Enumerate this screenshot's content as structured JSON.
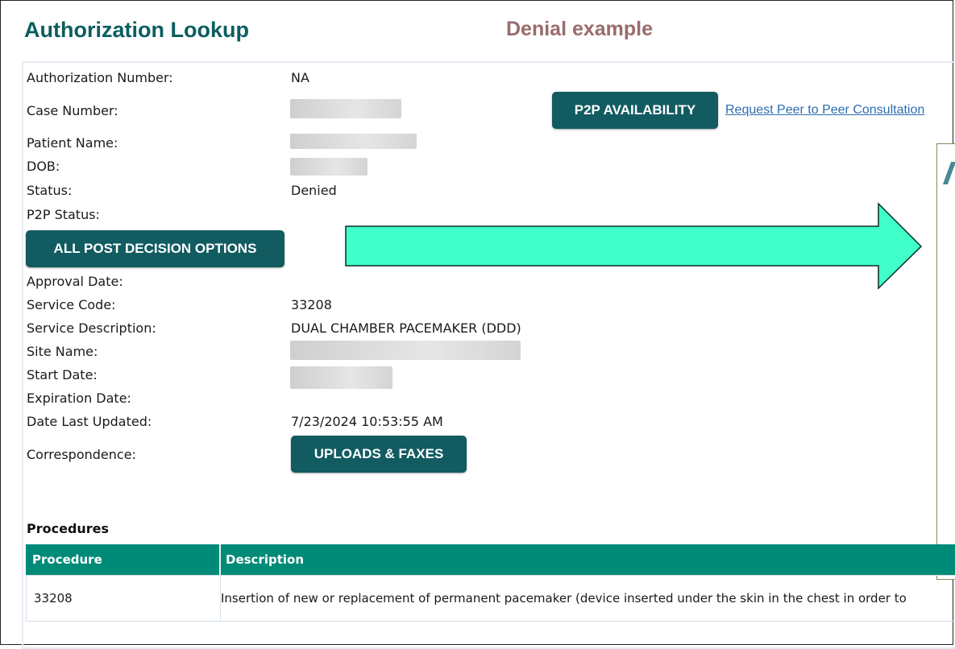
{
  "header": {
    "app_title": "Authorization Lookup",
    "slide_label": "Denial example"
  },
  "fields": {
    "authorization_number": {
      "label": "Authorization Number:",
      "value": "NA"
    },
    "case_number": {
      "label": "Case Number:"
    },
    "patient_name": {
      "label": "Patient Name:"
    },
    "dob": {
      "label": "DOB:"
    },
    "status": {
      "label": "Status:",
      "value": "Denied"
    },
    "p2p_status": {
      "label": "P2P Status:",
      "value": ""
    },
    "approval_date": {
      "label": "Approval Date:",
      "value": ""
    },
    "service_code": {
      "label": "Service Code:",
      "value": "33208"
    },
    "service_description": {
      "label": "Service Description:",
      "value": "DUAL CHAMBER PACEMAKER (DDD)"
    },
    "site_name": {
      "label": "Site Name:"
    },
    "start_date": {
      "label": "Start Date:"
    },
    "expiration_date": {
      "label": "Expiration Date:",
      "value": ""
    },
    "date_last_updated": {
      "label": "Date Last Updated:",
      "value": "7/23/2024 10:53:55 AM"
    },
    "correspondence": {
      "label": "Correspondence:"
    }
  },
  "buttons": {
    "p2p_availability": "P2P AVAILABILITY",
    "request_p2p_link": "Request Peer to Peer Consultation",
    "all_post_decision_options": "ALL POST DECISION OPTIONS",
    "uploads_faxes": "UPLOADS & FAXES"
  },
  "procedures": {
    "title": "Procedures",
    "columns": [
      "Procedure",
      "Description"
    ],
    "rows": [
      {
        "procedure": "33208",
        "description": "Insertion of new or replacement of permanent pacemaker (device inserted under the skin in the chest in order to"
      }
    ]
  },
  "colors": {
    "title_teal": "#0c5d60",
    "button_teal": "#115b61",
    "table_header": "#008a78",
    "arrow_fill": "#40ffc8",
    "slide_label": "#9a6b6b",
    "link": "#2d6db0"
  },
  "icons": [
    "right-arrow-icon"
  ]
}
